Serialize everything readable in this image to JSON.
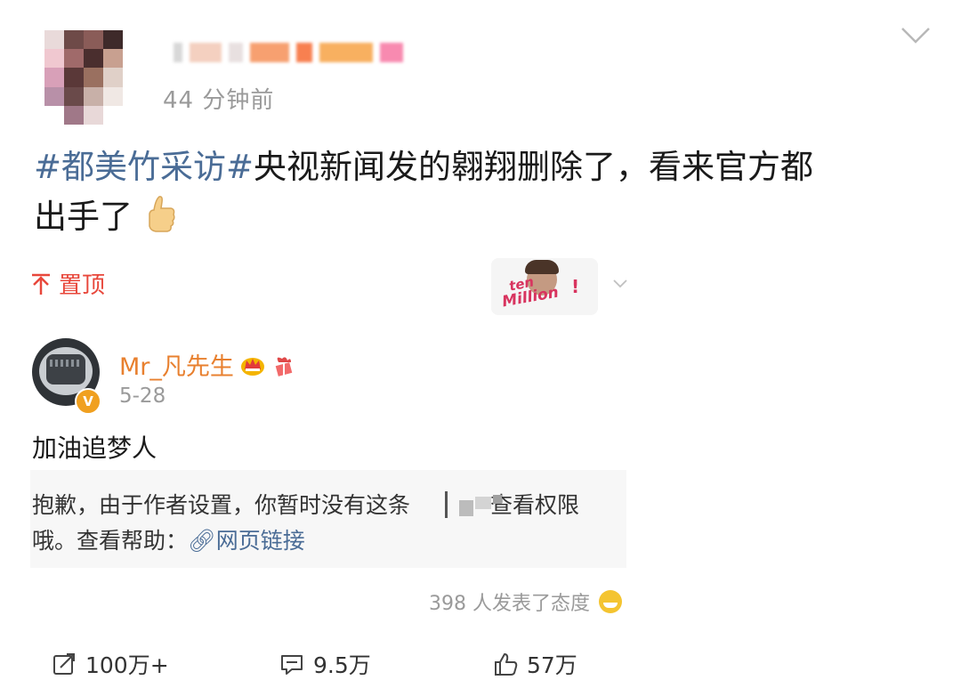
{
  "post": {
    "timestamp": "44 分钟前",
    "hashtag": "#都美竹采访#",
    "text_line1_rest": "央视新闻发的翱翔删除了，看来官方都",
    "text_line2": "出手了",
    "pin_label": "置顶",
    "sticker": {
      "word1": "ten",
      "word2": "Million",
      "mark": "!"
    }
  },
  "repost": {
    "username": "Mr_凡先生",
    "date": "5-28",
    "verified_badge": "V",
    "text": "加油追梦人",
    "notice_line1_a": "抱歉，由于作者设置，你暂时没有这条",
    "notice_line1_b": "查看权限",
    "notice_line2_a": "哦。查看帮助：",
    "notice_link": "网页链接",
    "attitude_text": "398 人发表了态度"
  },
  "actions": {
    "repost_count": "100万+",
    "comment_count": "9.5万",
    "like_count": "57万"
  },
  "colors": {
    "hashtag": "#4a6c96",
    "pin": "#e8473b",
    "username": "#e8802f",
    "meta": "#9a9a9a"
  }
}
